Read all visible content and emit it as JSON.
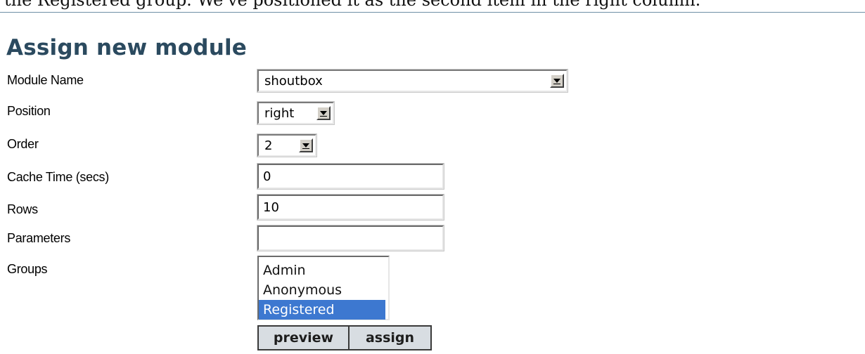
{
  "intro_text": "the Registered group. We've positioned it as the second item in the right column.",
  "section_title": "Assign new module",
  "form": {
    "module_name": {
      "label": "Module Name",
      "value": "shoutbox"
    },
    "position": {
      "label": "Position",
      "value": "right"
    },
    "order": {
      "label": "Order",
      "value": "2"
    },
    "cache_time": {
      "label": "Cache Time (secs)",
      "value": "0"
    },
    "rows": {
      "label": "Rows",
      "value": "10"
    },
    "parameters": {
      "label": "Parameters",
      "value": ""
    },
    "groups": {
      "label": "Groups",
      "options": [
        "Admin",
        "Anonymous",
        "Registered"
      ],
      "selected": "Registered"
    }
  },
  "buttons": {
    "preview": "preview",
    "assign": "assign"
  },
  "colors": {
    "title": "#2b4a5f",
    "selection": "#3d78d0",
    "button_bg": "#d8dde2"
  }
}
